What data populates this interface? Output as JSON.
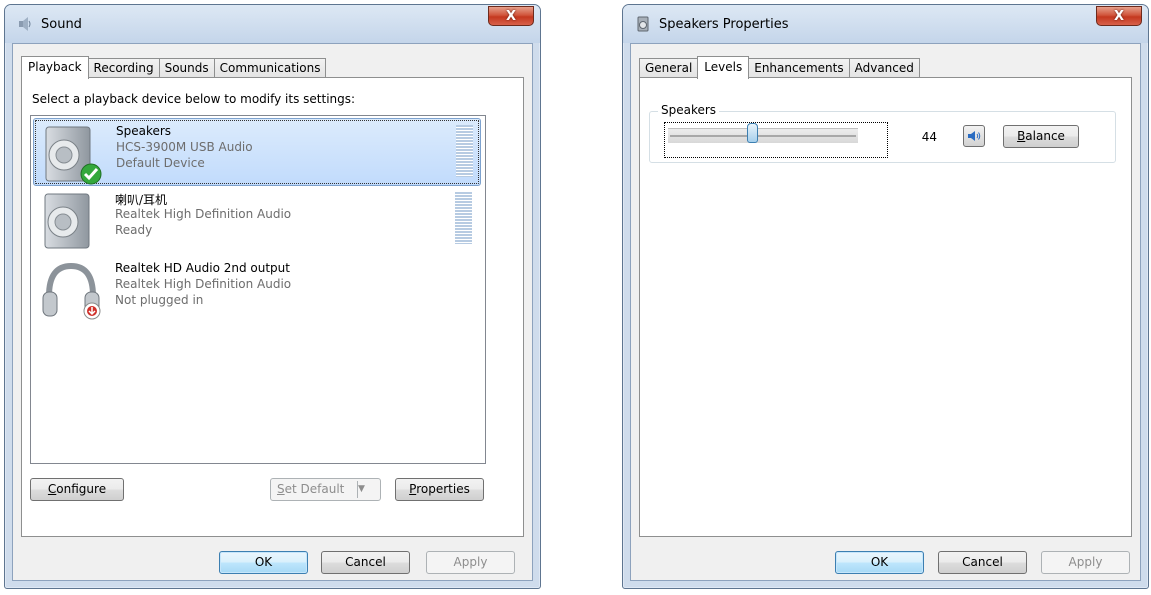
{
  "sound_window": {
    "title": "Sound",
    "tabs": [
      {
        "label": "Playback",
        "active": true
      },
      {
        "label": "Recording",
        "active": false
      },
      {
        "label": "Sounds",
        "active": false
      },
      {
        "label": "Communications",
        "active": false
      }
    ],
    "instruction": "Select a playback device below to modify its settings:",
    "devices": [
      {
        "name": "Speakers",
        "description": "HCS-3900M USB Audio",
        "status": "Default Device",
        "icon": "speaker-icon",
        "badge": "default-check-icon",
        "selected": true,
        "meter": true
      },
      {
        "name": "喇叭/耳机",
        "description": "Realtek High Definition Audio",
        "status": "Ready",
        "icon": "speaker-icon",
        "selected": false,
        "meter": true
      },
      {
        "name": "Realtek HD Audio 2nd output",
        "description": "Realtek High Definition Audio",
        "status": "Not plugged in",
        "icon": "headphones-icon",
        "badge": "unplugged-icon",
        "selected": false,
        "meter": false
      }
    ],
    "buttons": {
      "configure_prefix": "C",
      "configure_rest": "onfigure",
      "set_default_prefix": "S",
      "set_default_rest": "et Default",
      "properties_prefix": "P",
      "properties_rest": "roperties",
      "ok": "OK",
      "cancel": "Cancel",
      "apply": "Apply"
    }
  },
  "props_window": {
    "title": "Speakers Properties",
    "tabs": [
      {
        "label": "General",
        "active": false
      },
      {
        "label": "Levels",
        "active": true
      },
      {
        "label": "Enhancements",
        "active": false
      },
      {
        "label": "Advanced",
        "active": false
      }
    ],
    "group_title": "Speakers",
    "level_value": "44",
    "level_fraction": 0.44,
    "buttons": {
      "balance_prefix": "B",
      "balance_rest": "alance",
      "ok": "OK",
      "cancel": "Cancel",
      "apply": "Apply"
    }
  },
  "colors": {
    "selection": "#c1dbfc",
    "accent": "#3c7fb1",
    "close": "#c4381f",
    "check": "#34a83c"
  }
}
